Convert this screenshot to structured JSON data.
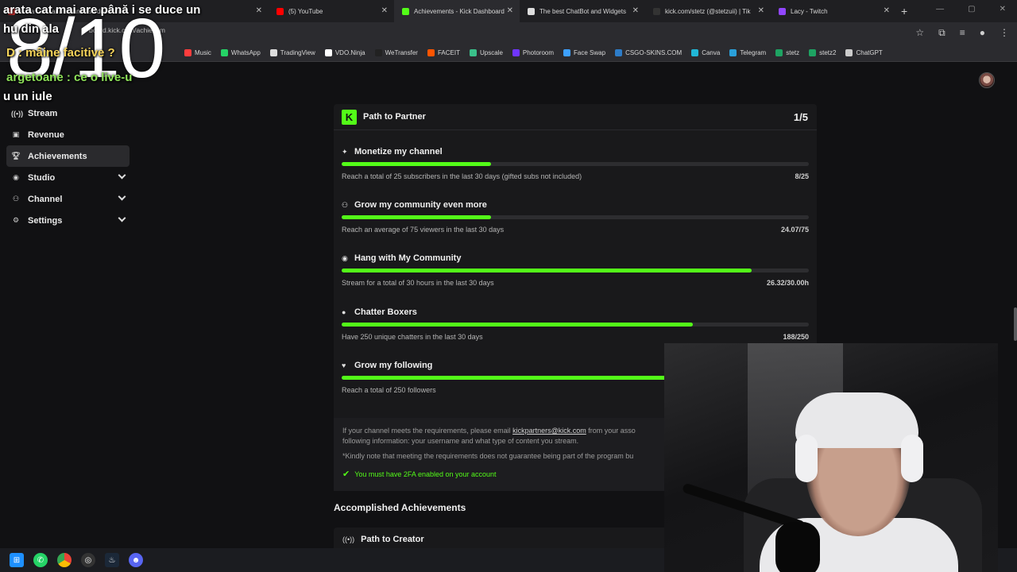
{
  "browser": {
    "tabs": [
      {
        "label": "arata cat mai are până i se duce un",
        "color": "#e33b3b"
      },
      {
        "label": "(5) YouTube",
        "color": "#ff0000"
      },
      {
        "label": "Achievements - Kick Dashboard",
        "color": "#53fc18"
      },
      {
        "label": "The best ChatBot and Widgets",
        "color": "#dddddd"
      },
      {
        "label": "kick.com/stetz (@stetzuii) | Tik",
        "color": "#222222"
      },
      {
        "label": "Lacy - Twitch",
        "color": "#9146ff"
      }
    ],
    "new_tab": "+",
    "url": "board.kick.com/achievem",
    "bookmarks": [
      {
        "label": "Music",
        "color": "#ff3d3d"
      },
      {
        "label": "WhatsApp",
        "color": "#25d366"
      },
      {
        "label": "TradingView",
        "color": "#dddddd"
      },
      {
        "label": "VDO.Ninja",
        "color": "#ffffff"
      },
      {
        "label": "WeTransfer",
        "color": "#222222"
      },
      {
        "label": "FACEIT",
        "color": "#ff5500"
      },
      {
        "label": "Upscale",
        "color": "#3ac08a"
      },
      {
        "label": "Photoroom",
        "color": "#6f35ff"
      },
      {
        "label": "Face Swap",
        "color": "#3da0ff"
      },
      {
        "label": "CSGO-SKINS.COM",
        "color": "#2d7cc8"
      },
      {
        "label": "Canva",
        "color": "#21b6d6"
      },
      {
        "label": "Telegram",
        "color": "#2aa0da"
      },
      {
        "label": "stetz",
        "color": "#1ea362"
      },
      {
        "label": "stetz2",
        "color": "#1ea362"
      },
      {
        "label": "ChatGPT",
        "color": "#cccccc"
      }
    ]
  },
  "sidebar": {
    "items": [
      {
        "label": "Stream",
        "icon": "broadcast-icon"
      },
      {
        "label": "Revenue",
        "icon": "revenue-icon"
      },
      {
        "label": "Achievements",
        "icon": "trophy-icon"
      },
      {
        "label": "Studio",
        "icon": "studio-icon"
      },
      {
        "label": "Channel",
        "icon": "channel-icon"
      },
      {
        "label": "Settings",
        "icon": "gear-icon"
      }
    ]
  },
  "partner": {
    "logo_letter": "K",
    "title": "Path to Partner",
    "count": "1/5",
    "goals": [
      {
        "title": "Monetize my channel",
        "icon": "sparkle-icon",
        "desc": "Reach a total of 25 subscribers in the last 30 days (gifted subs not included)",
        "value": "8/25",
        "progress": 0.32
      },
      {
        "title": "Grow my community even more",
        "icon": "people-icon",
        "desc": "Reach an average of 75 viewers in the last 30 days",
        "value": "24.07/75",
        "progress": 0.32
      },
      {
        "title": "Hang with My Community",
        "icon": "broadcast-icon",
        "desc": "Stream for a total of 30 hours in the last 30 days",
        "value": "26.32/30.00h",
        "progress": 0.877
      },
      {
        "title": "Chatter Boxers",
        "icon": "chat-icon",
        "desc": "Have 250 unique chatters in the last 30 days",
        "value": "188/250",
        "progress": 0.752
      },
      {
        "title": "Grow my following",
        "icon": "heart-icon",
        "desc": "Reach a total of 250 followers",
        "value": "",
        "progress": 1.0
      }
    ],
    "note_line1_pre": "If your channel meets the requirements, please email ",
    "note_email": "kickpartners@kick.com",
    "note_line1_post": " from your asso",
    "note_line2": "following information: your username and what type of content you stream.",
    "note_line3": "*Kindly note that meeting the requirements does not guarantee being part of the program bu",
    "twofa": "You must have 2FA enabled on your account"
  },
  "accomplished": {
    "heading": "Accomplished Achievements",
    "items": [
      {
        "title": "Path to Creator",
        "icon": "broadcast-icon"
      }
    ]
  },
  "overlay": {
    "big_score": "8/10",
    "chat_lines": [
      "arata cat mai are până i se duce un",
      "hu    din ala",
      "D    : mâine facitive ?",
      "    argetoane :    ce o   live-u",
      "u    un   iule"
    ]
  },
  "colors": {
    "accent": "#53fc18",
    "bg": "#111113",
    "card": "#19191b"
  }
}
